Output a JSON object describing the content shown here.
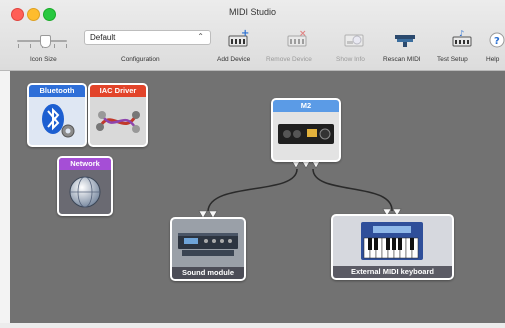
{
  "window": {
    "title": "MIDI Studio"
  },
  "toolbar": {
    "icon_size_label": "Icon Size",
    "configuration_label": "Configuration",
    "configuration_value": "Default",
    "add_device": "Add Device",
    "remove_device": "Remove Device",
    "show_info": "Show Info",
    "rescan_midi": "Rescan MIDI",
    "test_setup": "Test Setup",
    "help": "Help"
  },
  "devices": {
    "bluetooth": "Bluetooth",
    "iac_driver": "IAC Driver",
    "network": "Network",
    "m2": "M2",
    "sound_module": "Sound module",
    "external_keyboard": "External MIDI keyboard"
  },
  "colors": {
    "bluetooth_header": "#2f6fd8",
    "iac_header": "#e2442a",
    "network_header": "#a54ed6",
    "m2_header": "#5b9be6",
    "canvas": "#727272"
  },
  "icons": {
    "bluetooth": "bluetooth-icon",
    "iac_driver": "iac-cables-icon",
    "network": "network-globe-icon",
    "m2": "audio-interface-icon",
    "sound_module": "rack-module-icon",
    "external_keyboard": "keyboard-icon"
  }
}
